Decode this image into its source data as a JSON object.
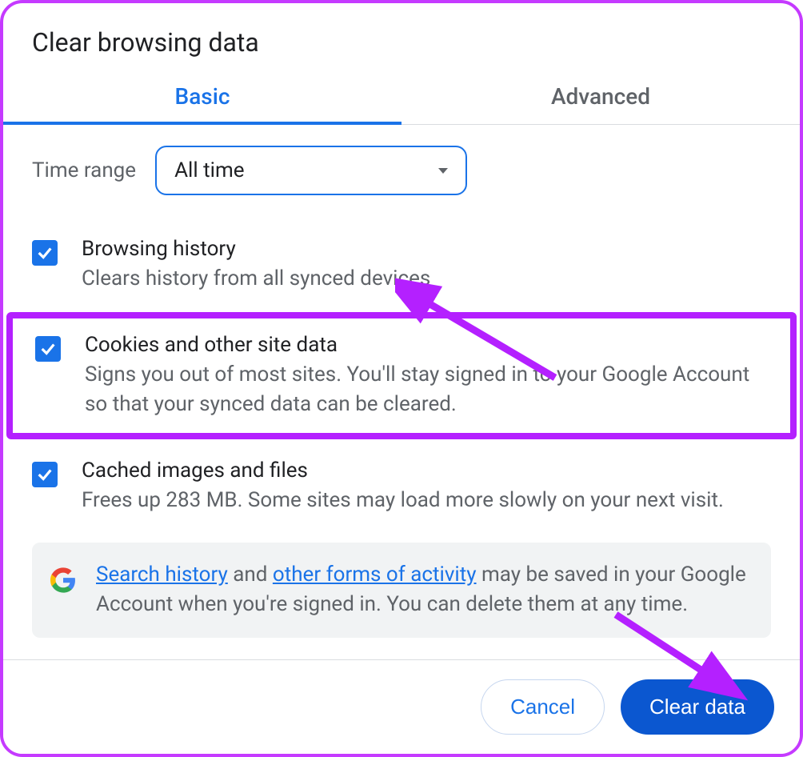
{
  "title": "Clear browsing data",
  "tabs": {
    "basic": "Basic",
    "advanced": "Advanced"
  },
  "time_range": {
    "label": "Time range",
    "value": "All time"
  },
  "options": {
    "browsing": {
      "title": "Browsing history",
      "desc": "Clears history from all synced devices"
    },
    "cookies": {
      "title": "Cookies and other site data",
      "desc": "Signs you out of most sites. You'll stay signed in to your Google Account so that your synced data can be cleared."
    },
    "cache": {
      "title": "Cached images and files",
      "desc": "Frees up 283 MB. Some sites may load more slowly on your next visit."
    }
  },
  "info": {
    "link1": "Search history",
    "mid1": " and ",
    "link2": "other forms of activity",
    "rest": " may be saved in your Google Account when you're signed in. You can delete them at any time."
  },
  "buttons": {
    "cancel": "Cancel",
    "clear": "Clear data"
  }
}
